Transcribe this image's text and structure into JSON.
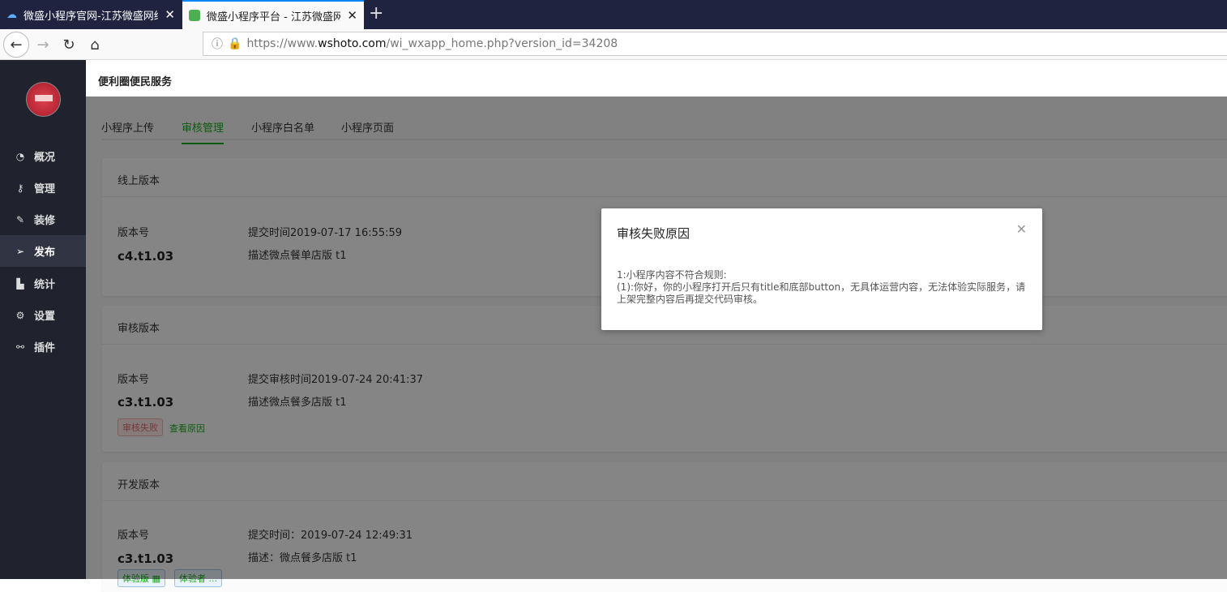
{
  "browser": {
    "tabs": [
      {
        "title": "微盛小程序官网-江苏微盛网络"
      },
      {
        "title": "微盛小程序平台 - 江苏微盛网络"
      }
    ],
    "url_prefix": "https://www.",
    "url_domain": "wshoto.com",
    "url_path": "/wi_wxapp_home.php?version_id=34208"
  },
  "sidebar": {
    "items": [
      {
        "label": "概况",
        "icon": "dashboard-icon"
      },
      {
        "label": "管理",
        "icon": "key-icon"
      },
      {
        "label": "装修",
        "icon": "brush-icon"
      },
      {
        "label": "发布",
        "icon": "send-icon"
      },
      {
        "label": "统计",
        "icon": "chart-icon"
      },
      {
        "label": "设置",
        "icon": "gear-icon"
      },
      {
        "label": "插件",
        "icon": "link-icon"
      }
    ],
    "active": "发布"
  },
  "header": {
    "title": "便利圈便民服务"
  },
  "tabs": [
    "小程序上传",
    "审核管理",
    "小程序白名单",
    "小程序页面"
  ],
  "cards": [
    {
      "title": "线上版本",
      "version_label": "版本号",
      "version": "c4.t1.03",
      "time": "提交时间2019-07-17 16:55:59",
      "desc": "描述微点餐单店版 t1"
    },
    {
      "title": "审核版本",
      "version_label": "版本号",
      "version": "c3.t1.03",
      "time": "提交审核时间2019-07-24 20:41:37",
      "desc": "描述微点餐多店版 t1",
      "status": "审核失败",
      "reason_link": "查看原因"
    },
    {
      "title": "开发版本",
      "version_label": "版本号",
      "version": "c3.t1.03",
      "time": "提交时间：2019-07-24 12:49:31",
      "desc": "描述：微点餐多店版 t1",
      "buttons": [
        "体验版 ▦",
        "体验者 ..."
      ]
    }
  ],
  "modal": {
    "title": "审核失败原因",
    "line1": "1:小程序内容不符合规则:",
    "line2": "(1):你好，你的小程序打开后只有title和底部button，无具体运营内容，无法体验实际服务，请上架完整内容后再提交代码审核。"
  }
}
